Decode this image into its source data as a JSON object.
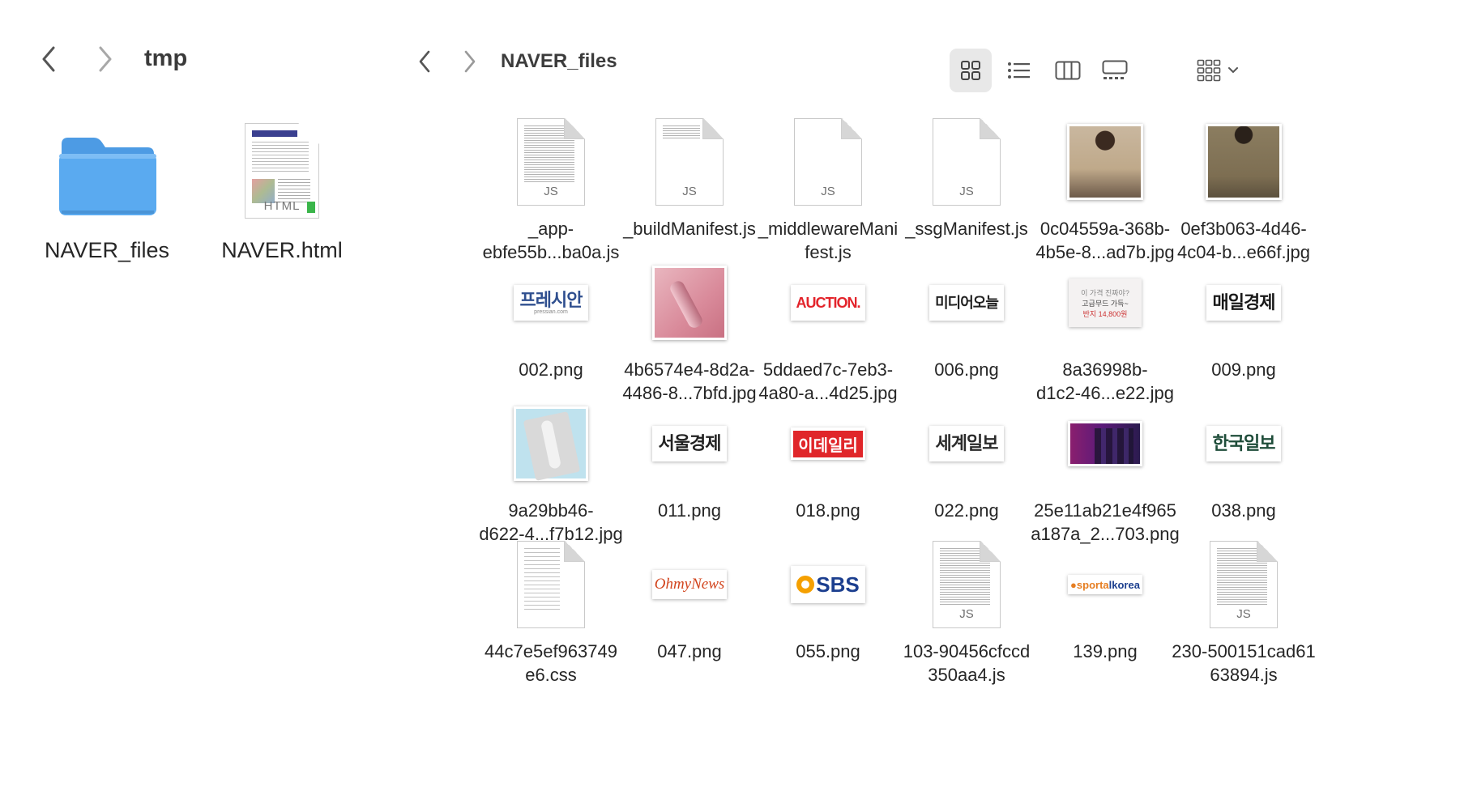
{
  "left_window": {
    "title": "tmp",
    "items": [
      {
        "name": "NAVER_files",
        "kind": "folder-icon"
      },
      {
        "name": "NAVER.html",
        "kind": "html-document-icon",
        "badge": "HTML"
      }
    ]
  },
  "right_window": {
    "title": "NAVER_files",
    "view_modes": [
      "icon-view",
      "list-view",
      "column-view",
      "gallery-view"
    ],
    "active_view": "icon-view",
    "group_menu": "group-by-menu"
  },
  "files": [
    {
      "line1": "_app-",
      "line2": "ebfe55b...ba0a.js",
      "kind": "js",
      "tag": "JS"
    },
    {
      "line1": "_buildManifest.js",
      "line2": "",
      "kind": "js-short",
      "tag": "JS"
    },
    {
      "line1": "_middlewareMani",
      "line2": "fest.js",
      "kind": "js-blank",
      "tag": "JS"
    },
    {
      "line1": "_ssgManifest.js",
      "line2": "",
      "kind": "js-tiny",
      "tag": "JS"
    },
    {
      "line1": "0c04559a-368b-",
      "line2": "4b5e-8...ad7b.jpg",
      "kind": "photo-beige"
    },
    {
      "line1": "0ef3b063-4d46-",
      "line2": "4c04-b...e66f.jpg",
      "kind": "photo-olive"
    },
    {
      "line1": "002.png",
      "line2": "",
      "kind": "logo",
      "logo_text": "프레시안",
      "logo_sub": "pressian.com",
      "color": "#2f4f8f"
    },
    {
      "line1": "4b6574e4-8d2a-",
      "line2": "4486-8...7bfd.jpg",
      "kind": "photo-pink"
    },
    {
      "line1": "5ddaed7c-7eb3-",
      "line2": "4a80-a...4d25.jpg",
      "kind": "logo",
      "logo_text": "AUCTION.",
      "color": "#e3242b"
    },
    {
      "line1": "006.png",
      "line2": "",
      "kind": "logo",
      "logo_text": "미디어오늘",
      "color": "#222222"
    },
    {
      "line1": "8a36998b-",
      "line2": "d1c2-46...e22.jpg",
      "kind": "ad",
      "logo_text": "고급무드 가득~",
      "logo_sub": "반지 14,800원",
      "color": "#444444"
    },
    {
      "line1": "009.png",
      "line2": "",
      "kind": "logo",
      "logo_text": "매일경제",
      "color": "#1a1a1a"
    },
    {
      "line1": "9a29bb46-",
      "line2": "d622-4...f7b12.jpg",
      "kind": "photo-mattress"
    },
    {
      "line1": "011.png",
      "line2": "",
      "kind": "logo",
      "logo_text": "서울경제",
      "color": "#222222"
    },
    {
      "line1": "018.png",
      "line2": "",
      "kind": "logo-red",
      "logo_text": "이데일리",
      "color": "#e0262a"
    },
    {
      "line1": "022.png",
      "line2": "",
      "kind": "logo",
      "logo_text": "세계일보",
      "color": "#2b2b2b"
    },
    {
      "line1": "25e11ab21e4f965",
      "line2": "a187a_2...703.png",
      "kind": "photo-purple"
    },
    {
      "line1": "038.png",
      "line2": "",
      "kind": "logo",
      "logo_text": "한국일보",
      "color": "#1f4d3a"
    },
    {
      "line1": "44c7e5ef963749",
      "line2": "e6.css",
      "kind": "css"
    },
    {
      "line1": "047.png",
      "line2": "",
      "kind": "logo-italic",
      "logo_text": "OhmyNews",
      "color": "#d2451e"
    },
    {
      "line1": "055.png",
      "line2": "",
      "kind": "logo-sbs",
      "logo_text": "SBS",
      "color": "#1c3f8f"
    },
    {
      "line1": "103-90456cfccd",
      "line2": "350aa4.js",
      "kind": "js",
      "tag": "JS"
    },
    {
      "line1": "139.png",
      "line2": "",
      "kind": "logo-sport",
      "logo_text": "sportalkorea",
      "color": "#e67e22"
    },
    {
      "line1": "230-500151cad61",
      "line2": "63894.js",
      "kind": "js",
      "tag": "JS"
    }
  ],
  "colors": {
    "folder": "#5aaaf0",
    "folder_tab": "#4d9be4",
    "active_toolbar": "#e8e8e8"
  }
}
